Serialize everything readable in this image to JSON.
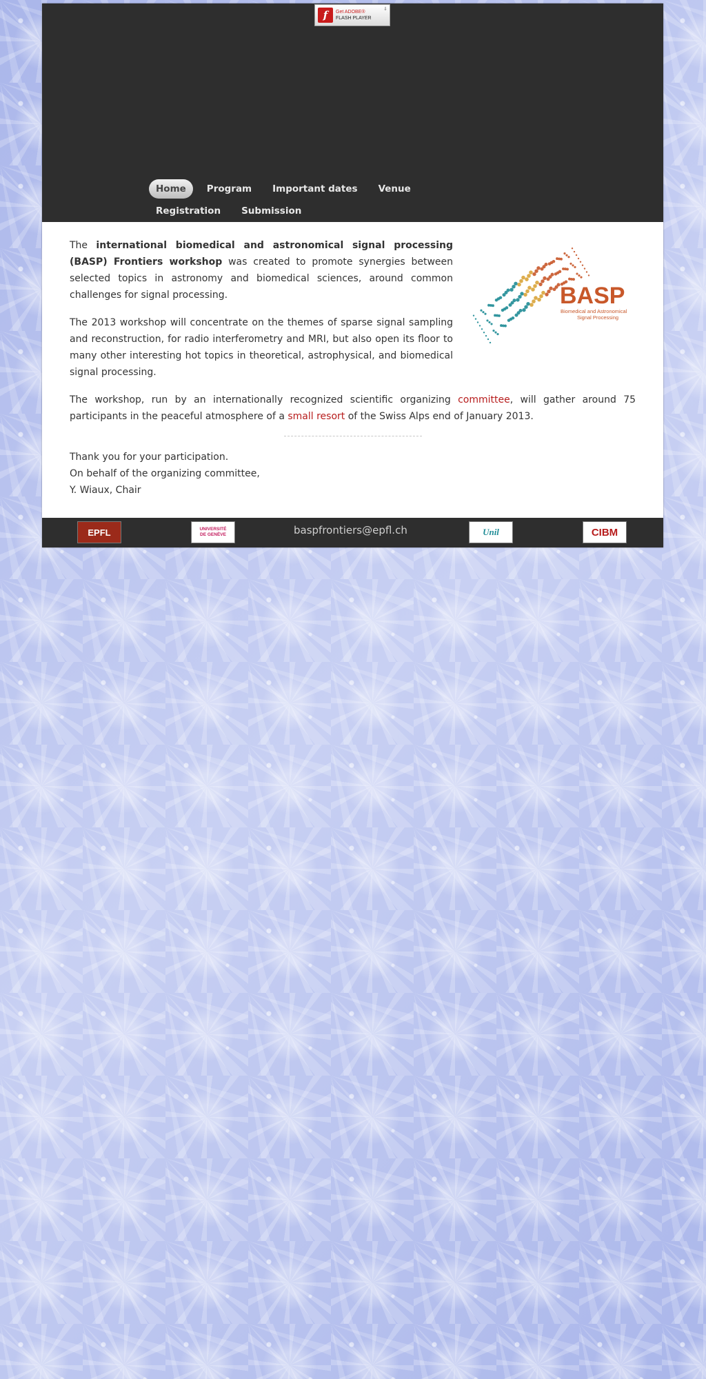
{
  "flash": {
    "line1": "Get ADOBE®",
    "line2": "FLASH PLAYER",
    "icon": "flash-player-icon"
  },
  "nav": {
    "items": [
      {
        "label": "Home",
        "active": true
      },
      {
        "label": "Program"
      },
      {
        "label": "Important dates"
      },
      {
        "label": "Venue"
      },
      {
        "label": "Registration"
      },
      {
        "label": "Submission"
      }
    ]
  },
  "logo": {
    "title": "BASP",
    "subtitle_line1": "Biomedical and Astronomical",
    "subtitle_line2": "Signal Processing"
  },
  "content": {
    "p1": {
      "pre": "The ",
      "bold": "international biomedical and astronomical signal processing (BASP) Frontiers workshop",
      "post": " was created to promote synergies between selected topics in astronomy and biomedical sciences, around common challenges for signal processing."
    },
    "p2": "The 2013 workshop will concentrate on the themes of sparse signal sampling and reconstruction, for radio interferometry and MRI, but also open its floor to many other interesting hot topics in theoretical, astrophysical, and biomedical signal processing.",
    "p3": {
      "a": "The workshop, run by an internationally recognized scientific organizing ",
      "link1": "committee",
      "b": ", will gather around 75 participants in the peaceful atmosphere of a ",
      "link2": "small resort",
      "c": " of the Swiss Alps end of January 2013."
    },
    "signature": {
      "line1": "Thank you for your participation.",
      "line2": "On behalf of the organizing committee,",
      "line3": "Y. Wiaux, Chair"
    }
  },
  "footer": {
    "email": "baspfrontiers@epfl.ch",
    "logos": {
      "epfl": "EPFL",
      "unige_line1": "UNIVERSITÉ",
      "unige_line2": "DE GENÈVE",
      "unil": "Unil",
      "cibm": "CIBM"
    }
  },
  "colors": {
    "header_bg": "#2e2e2e",
    "link": "#b71c1c",
    "logo_orange": "#c8582a",
    "logo_teal": "#1f8c96"
  }
}
